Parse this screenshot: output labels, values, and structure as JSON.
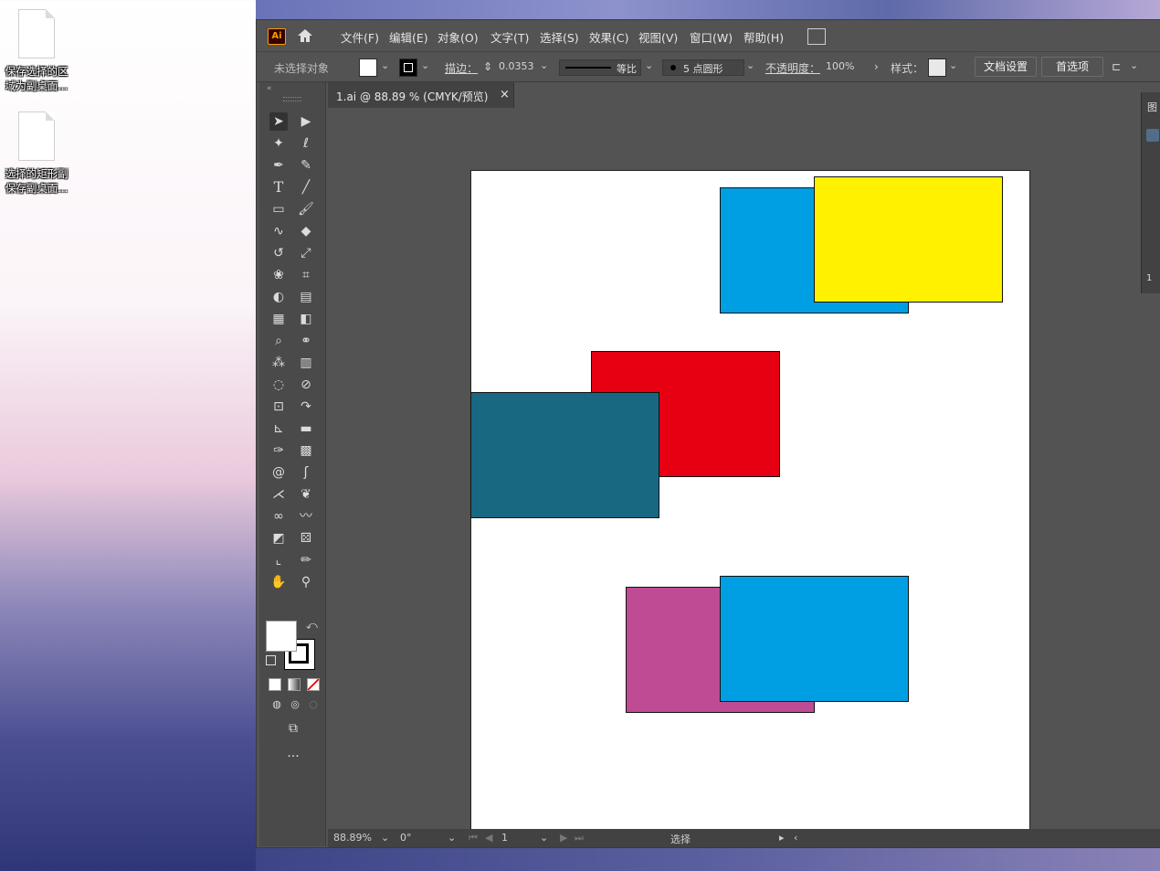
{
  "desktop": {
    "icons": [
      {
        "label_line1": "保存选择的区",
        "label_line2": "域为副桌面..."
      },
      {
        "label_line1": "选择的矩形副",
        "label_line2": "保存副桌面..."
      }
    ]
  },
  "menubar": {
    "logo": "Ai",
    "items": [
      "文件(F)",
      "编辑(E)",
      "对象(O)",
      "文字(T)",
      "选择(S)",
      "效果(C)",
      "视图(V)",
      "窗口(W)",
      "帮助(H)"
    ]
  },
  "control": {
    "no_selection": "未选择对象",
    "stroke_label": "描边：",
    "stroke_value": "0.0353",
    "profile_label": "等比",
    "brush_label": "5 点圆形",
    "opacity_label": "不透明度：",
    "opacity_value": "100%",
    "style_label": "样式：",
    "doc_setup_button": "文档设置",
    "preferences_button": "首选项"
  },
  "document": {
    "tab_title": "1.ai @ 88.89 % (CMYK/预览)",
    "close_glyph": "×"
  },
  "status": {
    "zoom": "88.89%",
    "rotation": "0°",
    "artboard": "1",
    "tool": "选择"
  },
  "right_panel": {
    "top_label": "图",
    "bottom_number": "1"
  },
  "colors": {
    "blue": "#009fe3",
    "yellow": "#fff100",
    "red": "#e60012",
    "teal": "#186882",
    "magenta": "#be4b93"
  }
}
